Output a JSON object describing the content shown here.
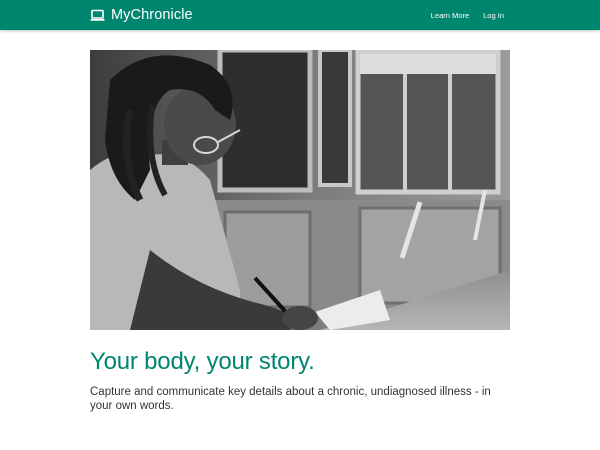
{
  "app": {
    "name": "MyChronicle",
    "brand_icon": "laptop-icon",
    "accent_color": "#00856f"
  },
  "nav": {
    "items": [
      {
        "label": "Learn More"
      },
      {
        "label": "Log In"
      }
    ]
  },
  "hero": {
    "image_style": "grayscale-photo",
    "headline": "Your body, your story.",
    "subtext": "Capture and communicate key details about a chronic, undiagnosed illness - in your own words."
  }
}
